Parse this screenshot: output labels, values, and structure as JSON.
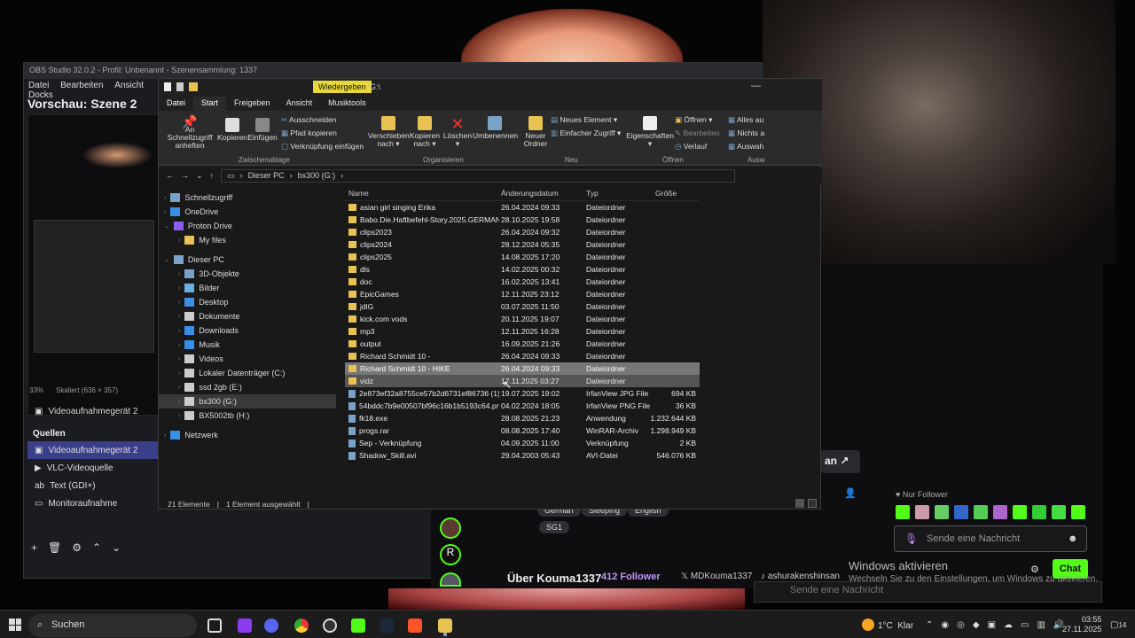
{
  "obs": {
    "title": "OBS Studio 32.0.2 - Profil: Unbenannt - Szenensammlung: 1337",
    "menu": [
      "Datei",
      "Bearbeiten",
      "Ansicht",
      "Docks"
    ],
    "preview_title": "Vorschau: Szene 2",
    "zoom": "33%",
    "scaled": "Skaliert (636 × 357)",
    "device_label": "Videoaufnahmegerät 2",
    "sources_title": "Quellen",
    "sources": [
      "Videoaufnahmegerät 2",
      "VLC-Videoquelle",
      "Text (GDI+)",
      "Monitoraufnahme"
    ]
  },
  "explorer": {
    "context_tab": "Wiedergeben",
    "path_title": "G:\\",
    "tabs": [
      "Datei",
      "Start",
      "Freigeben",
      "Ansicht",
      "Musiktools"
    ],
    "ribbon": {
      "pin": "An Schnellzugriff anheften",
      "copy": "Kopieren",
      "paste": "Einfügen",
      "cut": "Ausschneiden",
      "copy_path": "Pfad kopieren",
      "paste_link": "Verknüpfung einfügen",
      "move": "Verschieben nach",
      "copy_to": "Kopieren nach",
      "delete": "Löschen",
      "rename": "Umbenennen",
      "new_folder": "Neuer Ordner",
      "new_item": "Neues Element",
      "easy_access": "Einfacher Zugriff",
      "properties": "Eigenschaften",
      "open": "Öffnen",
      "edit": "Bearbeiten",
      "history": "Verlauf",
      "select_all": "Alles au",
      "select_none": "Nichts a",
      "invert": "Auswah",
      "groups": {
        "clipboard": "Zwischenablage",
        "organize": "Organisieren",
        "new": "Neu",
        "open": "Öffnen",
        "select": "Ausw"
      }
    },
    "address": [
      "Dieser PC",
      "bx300 (G:)"
    ],
    "nav": [
      {
        "label": "Schnellzugriff",
        "indent": 1
      },
      {
        "label": "OneDrive",
        "indent": 1
      },
      {
        "label": "Proton Drive",
        "indent": 1
      },
      {
        "label": "My files",
        "indent": 2
      },
      {
        "label": "Dieser PC",
        "indent": 1
      },
      {
        "label": "3D-Objekte",
        "indent": 2
      },
      {
        "label": "Bilder",
        "indent": 2
      },
      {
        "label": "Desktop",
        "indent": 2
      },
      {
        "label": "Dokumente",
        "indent": 2
      },
      {
        "label": "Downloads",
        "indent": 2
      },
      {
        "label": "Musik",
        "indent": 2
      },
      {
        "label": "Videos",
        "indent": 2
      },
      {
        "label": "Lokaler Datenträger (C:)",
        "indent": 2
      },
      {
        "label": "ssd 2gb (E:)",
        "indent": 2
      },
      {
        "label": "bx300 (G:)",
        "indent": 2
      },
      {
        "label": "BX5002tb (H:)",
        "indent": 2
      },
      {
        "label": "Netzwerk",
        "indent": 1
      }
    ],
    "columns": [
      "Name",
      "Änderungsdatum",
      "Typ",
      "Größe"
    ],
    "files": [
      {
        "name": "asian girl singing Erika",
        "date": "26.04.2024 09:33",
        "type": "Dateiordner",
        "size": "",
        "folder": true
      },
      {
        "name": "Babo.Die.Haftbefehl-Story.2025.GERMAN...",
        "date": "28.10.2025 19:58",
        "type": "Dateiordner",
        "size": "",
        "folder": true
      },
      {
        "name": "clips2023",
        "date": "26.04.2024 09:32",
        "type": "Dateiordner",
        "size": "",
        "folder": true
      },
      {
        "name": "clips2024",
        "date": "28.12.2024 05:35",
        "type": "Dateiordner",
        "size": "",
        "folder": true
      },
      {
        "name": "clips2025",
        "date": "14.08.2025 17:20",
        "type": "Dateiordner",
        "size": "",
        "folder": true
      },
      {
        "name": "dls",
        "date": "14.02.2025 00:32",
        "type": "Dateiordner",
        "size": "",
        "folder": true
      },
      {
        "name": "doc",
        "date": "16.02.2025 13:41",
        "type": "Dateiordner",
        "size": "",
        "folder": true
      },
      {
        "name": "EpicGames",
        "date": "12.11.2025 23:12",
        "type": "Dateiordner",
        "size": "",
        "folder": true
      },
      {
        "name": "jdlG",
        "date": "03.07.2025 11:50",
        "type": "Dateiordner",
        "size": "",
        "folder": true
      },
      {
        "name": "kick.com vods",
        "date": "20.11.2025 19:07",
        "type": "Dateiordner",
        "size": "",
        "folder": true
      },
      {
        "name": "mp3",
        "date": "12.11.2025 16:28",
        "type": "Dateiordner",
        "size": "",
        "folder": true
      },
      {
        "name": "output",
        "date": "16.09.2025 21:26",
        "type": "Dateiordner",
        "size": "",
        "folder": true
      },
      {
        "name": "Richard Schmidt 10 -",
        "date": "26.04.2024 09:33",
        "type": "Dateiordner",
        "size": "",
        "folder": true
      },
      {
        "name": "Richard Schmidt 10 - HIKE",
        "date": "26.04.2024 09:33",
        "type": "Dateiordner",
        "size": "",
        "folder": true,
        "selected": true
      },
      {
        "name": "vidz",
        "date": "17.11.2025 03:27",
        "type": "Dateiordner",
        "size": "",
        "folder": true,
        "hover": true
      },
      {
        "name": "2e873ef32a8755ce57b2d6731ef86736 (1).j...",
        "date": "19.07.2025 19:02",
        "type": "IrfanView JPG File",
        "size": "694 KB",
        "folder": false
      },
      {
        "name": "54bddc7b9e00507bf96c16b1b5193c64.png",
        "date": "04.02.2024 18:05",
        "type": "IrfanView PNG File",
        "size": "36 KB",
        "folder": false
      },
      {
        "name": "fk18.exe",
        "date": "28.08.2025 21:23",
        "type": "Anwendung",
        "size": "1.232.644 KB",
        "folder": false
      },
      {
        "name": "progs.rar",
        "date": "08.08.2025 17:40",
        "type": "WinRAR-Archiv",
        "size": "1.298.949 KB",
        "folder": false
      },
      {
        "name": "Sep - Verknüpfung",
        "date": "04.09.2025 11:00",
        "type": "Verknüpfung",
        "size": "2 KB",
        "folder": false
      },
      {
        "name": "Shadow_Skill.avi",
        "date": "29.04.2003 05:43",
        "type": "AVI-Datei",
        "size": "546.076 KB",
        "folder": false
      }
    ],
    "status_count": "21 Elemente",
    "status_selected": "1 Element ausgewählt"
  },
  "stream": {
    "tags": [
      "German",
      "Sleeping",
      "English",
      "SG1"
    ],
    "about": "Über Kouma1337",
    "followers": "412 Follower",
    "x_handle": "MDKouma1337",
    "tiktok_handle": "ashurakenshinsan",
    "follower_only": "Nur Follower",
    "chat_placeholder": "Sende eine Nachricht",
    "chat_button": "Chat",
    "button_text": "an",
    "behind_placeholder": "Sende eine Nachricht",
    "win_title": "Windows aktivieren",
    "win_sub": "Wechseln Sie zu den Einstellungen, um Windows zu aktivieren."
  },
  "taskbar": {
    "search": "Suchen",
    "temp": "1°C",
    "weather": "Klar",
    "time": "03:55",
    "date": "27.11.2025",
    "badge": "14"
  }
}
